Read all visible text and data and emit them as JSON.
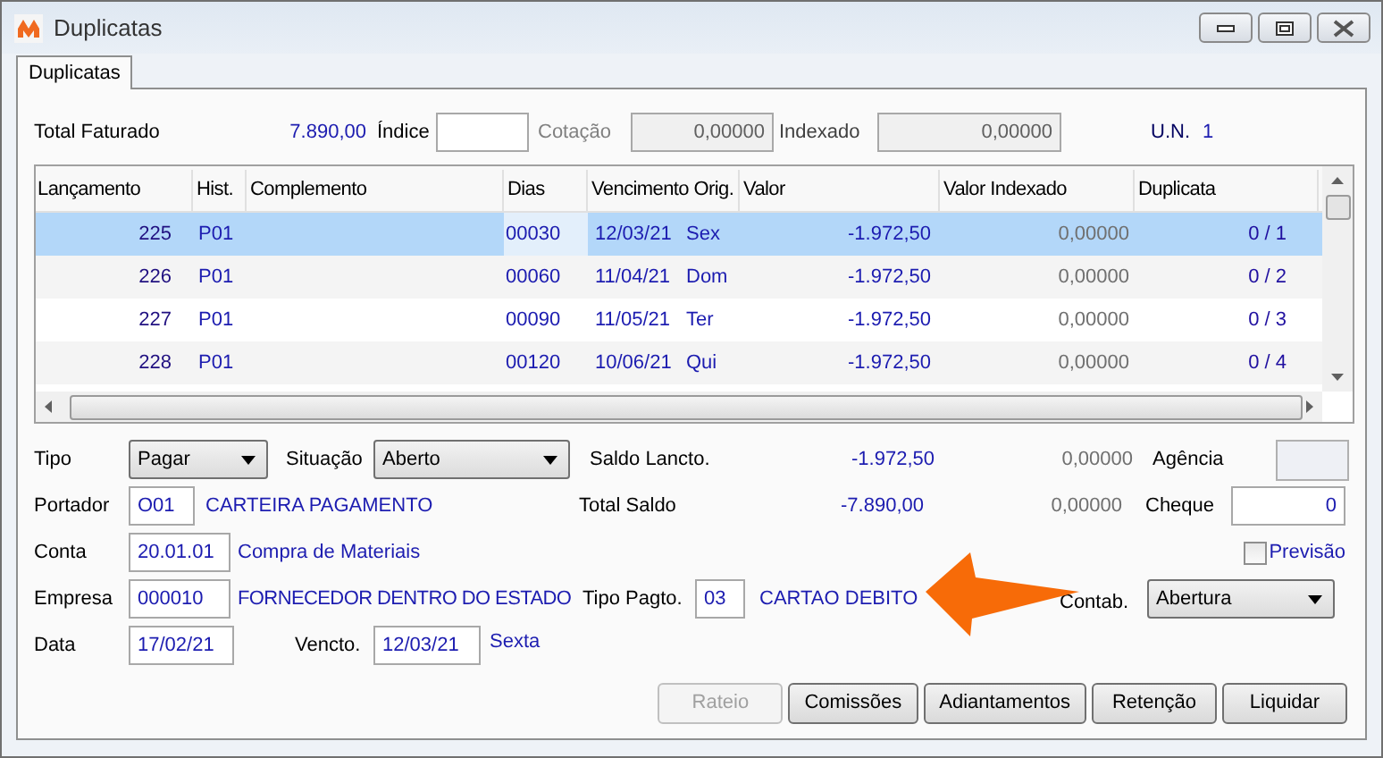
{
  "window": {
    "title": "Duplicatas"
  },
  "tabs": [
    {
      "label": "Duplicatas",
      "selected": true
    }
  ],
  "summary": {
    "total_faturado_label": "Total Faturado",
    "total_faturado": "7.890,00",
    "indice_label": "Índice",
    "cotacao_label": "Cotação",
    "cotacao": "0,00000",
    "indexado_label": "Indexado",
    "indexado": "0,00000",
    "un_label": "U.N.",
    "un": "1"
  },
  "table": {
    "columns": [
      "Lançamento",
      "Hist.",
      "Complemento",
      "Dias",
      "Vencimento Orig.",
      "Valor",
      "Valor Indexado",
      "Duplicata"
    ],
    "rows": [
      {
        "lancamento": "225",
        "hist": "P01",
        "dias": "00030",
        "vencimento": "12/03/21",
        "dia_semana": "Sex",
        "valor": "-1.972,50",
        "valor_indexado": "0,00000",
        "duplicata": "0 / 1",
        "selected": true
      },
      {
        "lancamento": "226",
        "hist": "P01",
        "dias": "00060",
        "vencimento": "11/04/21",
        "dia_semana": "Dom",
        "valor": "-1.972,50",
        "valor_indexado": "0,00000",
        "duplicata": "0 / 2",
        "selected": false
      },
      {
        "lancamento": "227",
        "hist": "P01",
        "dias": "00090",
        "vencimento": "11/05/21",
        "dia_semana": "Ter",
        "valor": "-1.972,50",
        "valor_indexado": "0,00000",
        "duplicata": "0 / 3",
        "selected": false
      },
      {
        "lancamento": "228",
        "hist": "P01",
        "dias": "00120",
        "vencimento": "10/06/21",
        "dia_semana": "Qui",
        "valor": "-1.972,50",
        "valor_indexado": "0,00000",
        "duplicata": "0 / 4",
        "selected": false
      }
    ]
  },
  "form": {
    "tipo": {
      "label": "Tipo",
      "value": "Pagar"
    },
    "situacao": {
      "label": "Situação",
      "value": "Aberto"
    },
    "saldo_lancto": {
      "label": "Saldo Lancto.",
      "valor": "-1.972,50",
      "indexado": "0,00000"
    },
    "agencia": {
      "label": "Agência"
    },
    "portador": {
      "label": "Portador",
      "code": "O01",
      "name": "CARTEIRA PAGAMENTO"
    },
    "total_saldo": {
      "label": "Total Saldo",
      "valor": "-7.890,00",
      "indexado": "0,00000"
    },
    "cheque": {
      "label": "Cheque",
      "value": "0"
    },
    "conta": {
      "label": "Conta",
      "code": "20.01.01",
      "name": "Compra de Materiais"
    },
    "previsao": {
      "label": "Previsão",
      "checked": false
    },
    "empresa": {
      "label": "Empresa",
      "code": "000010",
      "name": "FORNECEDOR DENTRO DO ESTADO"
    },
    "tipo_pagto": {
      "label": "Tipo Pagto.",
      "code": "03",
      "name": "CARTAO DEBITO"
    },
    "contab": {
      "label": "Contab.",
      "value": "Abertura"
    },
    "data": {
      "label": "Data",
      "value": "17/02/21"
    },
    "vencto": {
      "label": "Vencto.",
      "value": "12/03/21",
      "weekday": "Sexta"
    }
  },
  "buttons": [
    {
      "label": "Rateio",
      "disabled": true
    },
    {
      "label": "Comissões",
      "disabled": false
    },
    {
      "label": "Adiantamentos",
      "disabled": false
    },
    {
      "label": "Retenção",
      "disabled": false
    },
    {
      "label": "Liquidar",
      "disabled": false
    }
  ]
}
